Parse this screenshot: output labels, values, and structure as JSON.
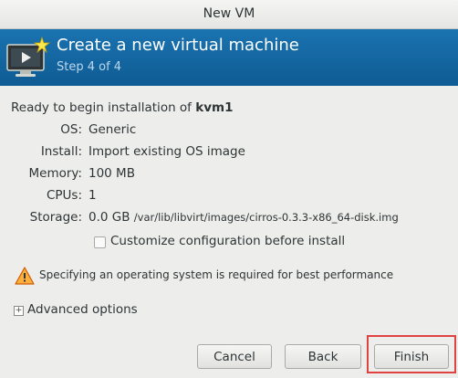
{
  "window": {
    "title": "New VM"
  },
  "banner": {
    "title": "Create a new virtual machine",
    "step": "Step 4 of 4",
    "icon": "vm-monitor-icon"
  },
  "summary": {
    "ready_prefix": "Ready to begin installation of ",
    "vm_name": "kvm1",
    "rows": [
      {
        "label": "OS:",
        "value": "Generic"
      },
      {
        "label": "Install:",
        "value": "Import existing OS image"
      },
      {
        "label": "Memory:",
        "value": "100 MB"
      },
      {
        "label": "CPUs:",
        "value": "1"
      },
      {
        "label": "Storage:",
        "value": "0.0 GB",
        "path": "/var/lib/libvirt/images/cirros-0.3.3-x86_64-disk.img"
      }
    ]
  },
  "customize": {
    "label": "Customize configuration before install",
    "checked": false
  },
  "warning": {
    "text": "Specifying an operating system is required for best performance",
    "icon": "warning-icon"
  },
  "advanced": {
    "label": "Advanced options",
    "expander": "+"
  },
  "buttons": {
    "cancel": "Cancel",
    "back": "Back",
    "finish": "Finish"
  },
  "colors": {
    "banner": "#1a73b0",
    "highlight": "#e04141"
  }
}
